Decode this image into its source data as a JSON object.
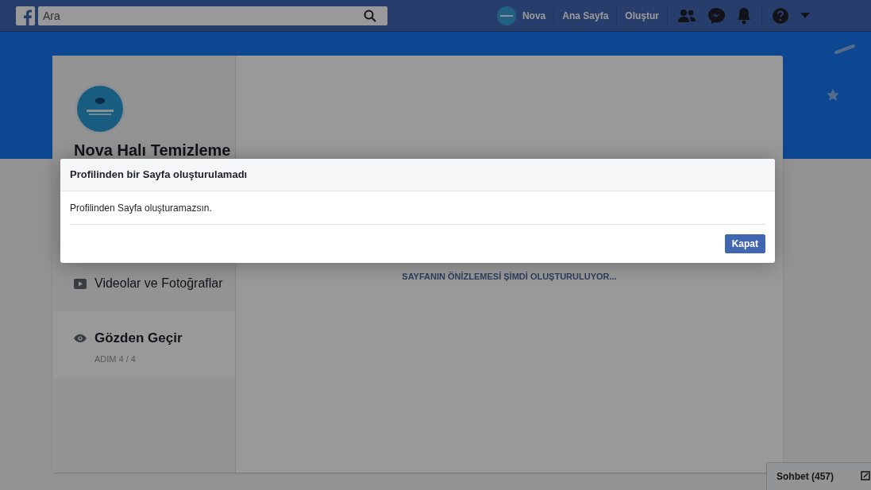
{
  "topbar": {
    "search": {
      "placeholder": "Ara"
    },
    "profile_name": "Nova",
    "links": [
      "Ana Sayfa",
      "Oluştur"
    ]
  },
  "page_setup": {
    "page_name": "Nova Halı Temizleme",
    "steps": [
      {
        "kind": "video",
        "label": "Videolar ve Fotoğraflar",
        "selected": false
      },
      {
        "kind": "review",
        "label": "Gözden Geçir",
        "selected": true,
        "step": "ADIM 4 / 4"
      }
    ],
    "preview_status": "SAYFANIN ÖNİZLEMESİ ŞİMDİ OLUŞTURULUYOR..."
  },
  "dialog": {
    "title": "Profilinden bir Sayfa oluşturulamadı",
    "message": "Profilinden Sayfa oluşturamazsın.",
    "button": "Kapat"
  },
  "chat": {
    "label": "Sohbet (457)"
  }
}
